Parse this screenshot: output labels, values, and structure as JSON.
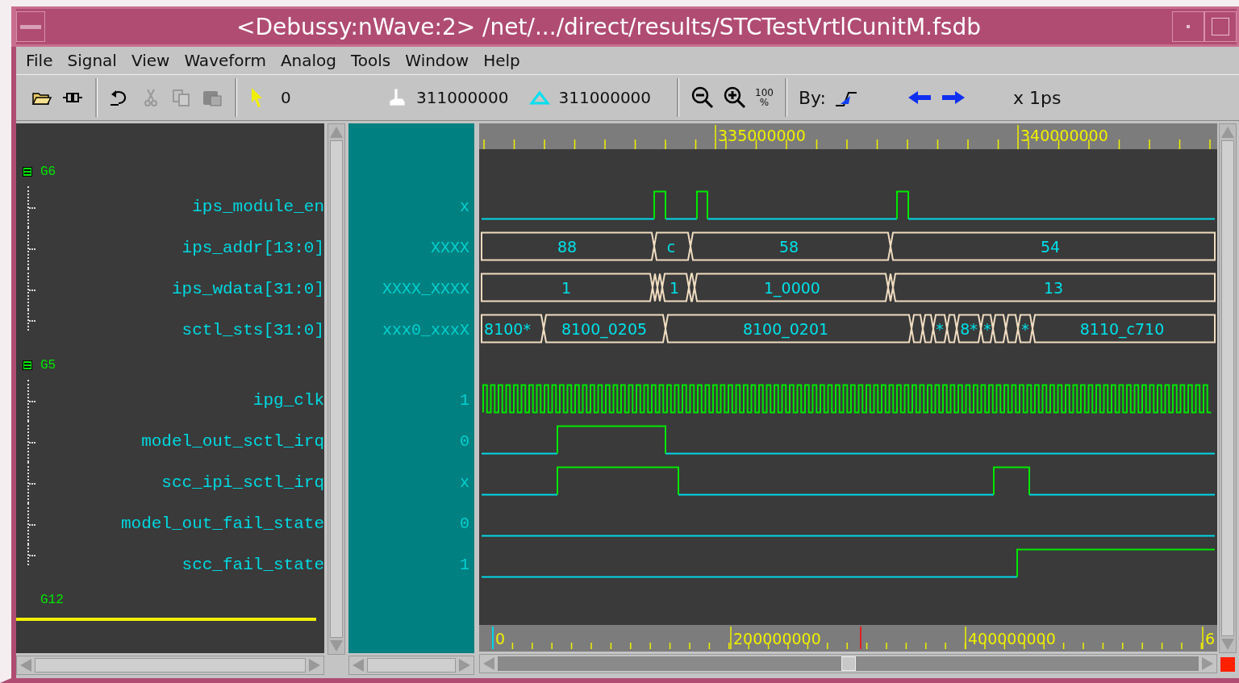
{
  "window": {
    "title": "<Debussy:nWave:2> /net/.../direct/results/STCTestVrtlCunitM.fsdb"
  },
  "menu": [
    "File",
    "Signal",
    "View",
    "Waveform",
    "Analog",
    "Tools",
    "Window",
    "Help"
  ],
  "toolbar": {
    "cursor_time": "0",
    "hand_time": "311000000",
    "marker_time": "311000000",
    "fit_label": [
      "100",
      "%"
    ],
    "by_label": "By:",
    "unit": "x 1ps"
  },
  "groups": [
    {
      "name": "G6",
      "children": [
        {
          "name": "ips_module_en",
          "value": "x",
          "kind": "bit"
        },
        {
          "name": "ips_addr[13:0]",
          "value": "XXXX",
          "kind": "bus",
          "segments": [
            "88",
            "c",
            "58",
            "54"
          ]
        },
        {
          "name": "ips_wdata[31:0]",
          "value": "XXXX_XXXX",
          "kind": "bus",
          "segments": [
            "1",
            "1",
            "1_0000",
            "13"
          ]
        },
        {
          "name": "sctl_sts[31:0]",
          "value": "xxx0_xxxX",
          "kind": "bus",
          "segments": [
            "8100*",
            "8100_0205",
            "8100_0201",
            "*",
            "8*",
            "*",
            "*",
            "8110_c710"
          ]
        }
      ]
    },
    {
      "name": "G5",
      "children": [
        {
          "name": "ipg_clk",
          "value": "1",
          "kind": "clock"
        },
        {
          "name": "model_out_sctl_irq",
          "value": "0",
          "kind": "bit"
        },
        {
          "name": "scc_ipi_sctl_irq",
          "value": "x",
          "kind": "bit"
        },
        {
          "name": "model_out_fail_state",
          "value": "0",
          "kind": "bit"
        },
        {
          "name": "scc_fail_state",
          "value": "1",
          "kind": "bit"
        }
      ]
    },
    {
      "name": "G12"
    }
  ],
  "top_ruler": [
    "335000000",
    "340000000"
  ],
  "bottom_ruler": [
    "0",
    "200000000",
    "400000000",
    "6"
  ]
}
